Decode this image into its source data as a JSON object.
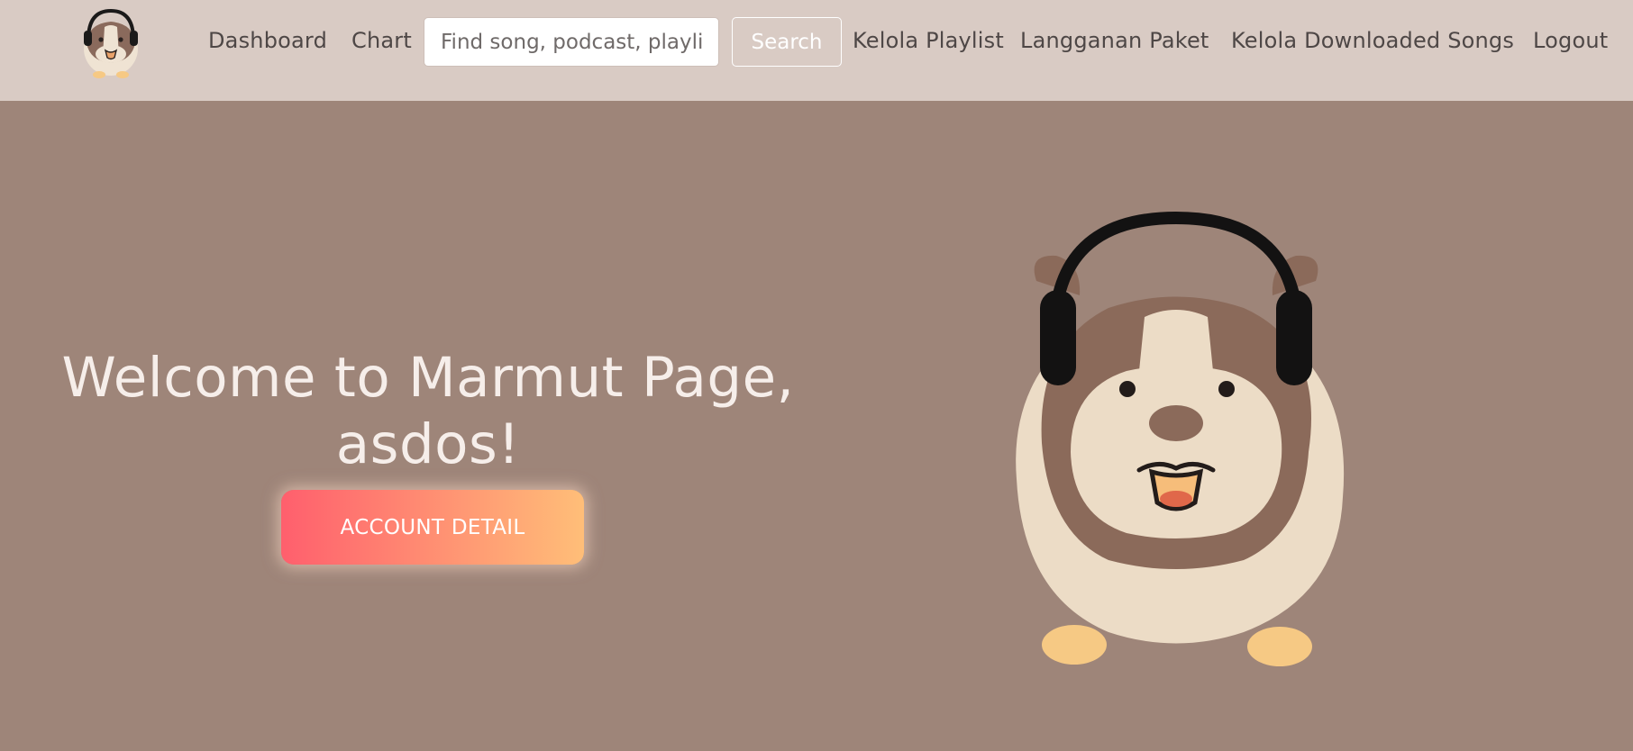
{
  "nav": {
    "links": [
      {
        "label": "Dashboard"
      },
      {
        "label": "Chart"
      },
      {
        "label": "Kelola Playlist"
      },
      {
        "label": "Langganan Paket"
      },
      {
        "label": "Kelola Downloaded Songs"
      },
      {
        "label": "Logout"
      }
    ],
    "search": {
      "placeholder": "Find song, podcast, playlist...",
      "value": "",
      "button_label": "Search"
    },
    "logo_icon": "guinea-pig-headphones-logo"
  },
  "hero": {
    "title": "Welcome to Marmut Page, asdos!",
    "button_label": "ACCOUNT DETAIL",
    "illustration": "guinea-pig-with-headphones"
  },
  "colors": {
    "navbar_bg": "#d9cbc4",
    "page_bg": "#9e8579",
    "nav_text": "#4e4746",
    "button_gradient_start": "#ff5f6d",
    "button_gradient_end": "#ffbe78",
    "title_text": "#f6eeea"
  }
}
